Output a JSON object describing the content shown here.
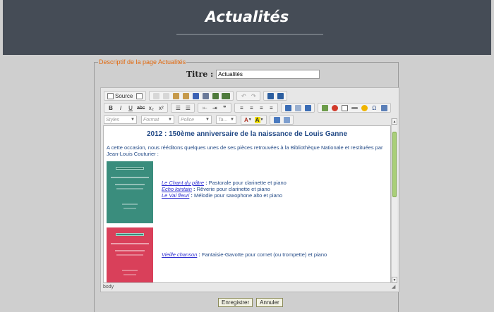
{
  "header": {
    "title": "Actualités"
  },
  "form": {
    "legend": "Descriptif de la page Actualités",
    "title_label": "Titre :",
    "title_value": "Actualités"
  },
  "toolbar": {
    "source_label": "Source",
    "bold": "B",
    "italic": "I",
    "underline": "U",
    "strike": "abc",
    "subscript": "x₂",
    "superscript": "x²",
    "styles": "Styles",
    "format": "Format",
    "font": "Police",
    "size": "Ta..."
  },
  "content": {
    "heading": "2012 : 150ème anniversaire de la naissance de Louis Ganne",
    "intro": "A cette occasion, nous rééditons quelques unes de ses pièces retrouvées à la Bibliothèque Nationale et restituées par Jean-Louis Couturier :",
    "works_a": [
      {
        "title": "Le Chant du pâtre",
        "sep": " : ",
        "desc": "Pastorale pour clarinette et piano"
      },
      {
        "title": "Echo lointain",
        "sep": " : ",
        "desc": "Rêverie pour clarinette et piano"
      },
      {
        "title": "Le Val fleuri",
        "sep": " : ",
        "desc": "Mélodie pour saxophone alto et piano"
      }
    ],
    "works_b": [
      {
        "title": "Vieille chanson",
        "sep": " : ",
        "desc": "Fantaisie-Gavotte pour cornet (ou trompette) et piano"
      }
    ]
  },
  "statusbar": {
    "path": "body"
  },
  "actions": {
    "save": "Enregistrer",
    "cancel": "Annuler"
  },
  "colors": {
    "header_bg": "#454c56",
    "legend": "#e16a10",
    "text": "#234a86",
    "link": "#2b2bd0",
    "cover_green": "#3a8d7d",
    "cover_red": "#d9405a",
    "scroll_thumb": "#a9cf78"
  }
}
